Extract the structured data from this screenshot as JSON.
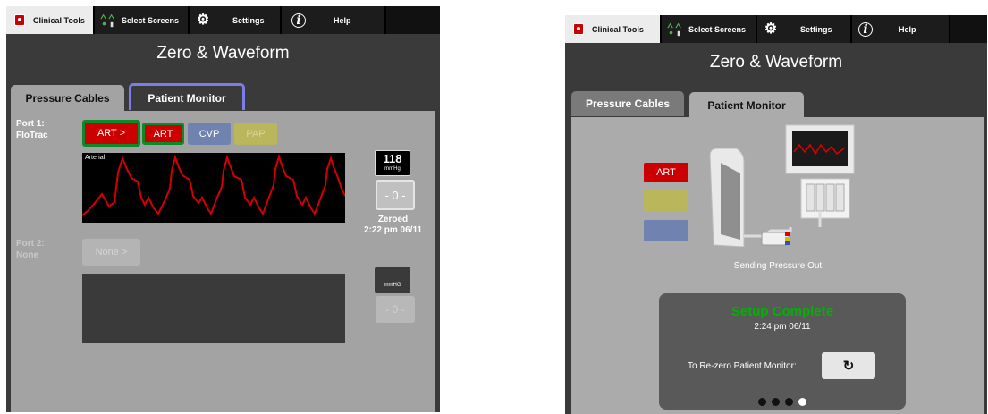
{
  "topbar": {
    "clinical_tools": "Clinical Tools",
    "select_screens": "Select Screens",
    "settings": "Settings",
    "help": "Help"
  },
  "title": "Zero & Waveform",
  "tabs": {
    "pressure_cables": "Pressure Cables",
    "patient_monitor": "Patient Monitor"
  },
  "left": {
    "port1": {
      "label_line1": "Port 1:",
      "label_line2": "FloTrac",
      "select": "ART >"
    },
    "channels": [
      "ART",
      "CVP",
      "PAP"
    ],
    "waveform_label": "Arterial",
    "value": {
      "number": "118",
      "unit": "mmHg"
    },
    "zero_button": "- 0 -",
    "zeroed": {
      "line1": "Zeroed",
      "line2": "2:22 pm 06/11"
    },
    "port2": {
      "label_line1": "Port 2:",
      "label_line2": "None",
      "select": "None >"
    },
    "value2": {
      "unit": "mmHG"
    },
    "zero_button2": "- 0 -"
  },
  "right": {
    "art_label": "ART",
    "sending": "Sending Pressure Out",
    "setup": {
      "status": "Setup Complete",
      "time": "2:24 pm 06/11",
      "rezero_label": "To Re-zero Patient Monitor:",
      "rezero_icon": "refresh-icon"
    },
    "pager": {
      "count": 4,
      "active": 4
    }
  },
  "colors": {
    "art_red": "#cc0000",
    "cvp_blue": "#6f82b0",
    "pap_yellow": "#b9b65c",
    "setup_green": "#00b300"
  }
}
